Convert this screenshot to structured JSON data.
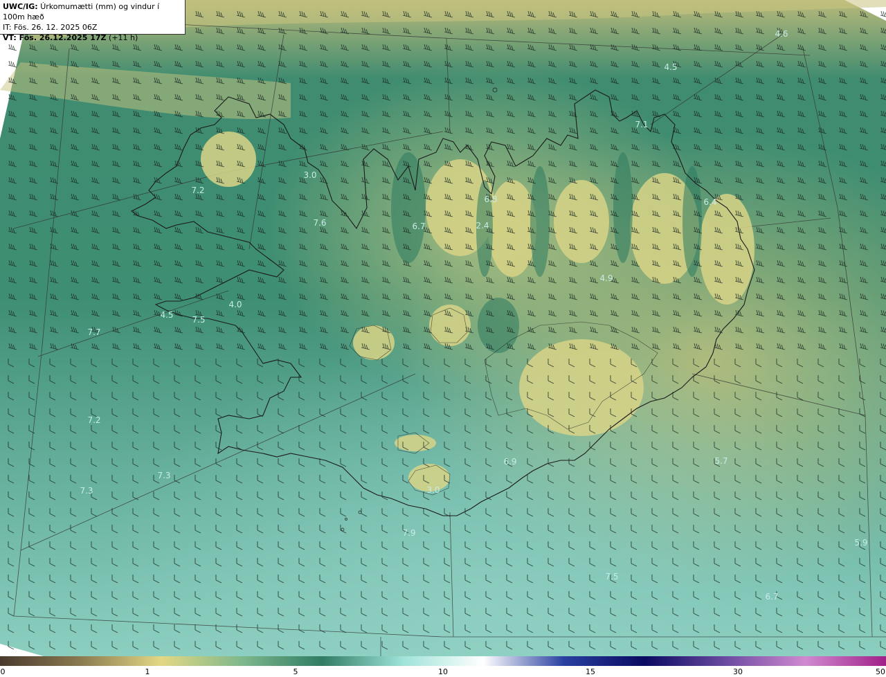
{
  "header": {
    "product_code": "UWC/IG:",
    "product_desc": "Úrkomumætti (mm) og vindur í 100m hæð",
    "it_line": "IT: Fös. 26. 12. 2025 06Z",
    "vt_label": "VT: Fös. 26.12.2025 17Z",
    "vt_offset": "(+11 h)"
  },
  "colorbar": {
    "ticks": [
      "0",
      "1",
      "5",
      "10",
      "15",
      "30",
      "50"
    ],
    "colors": [
      "#4a3a2e",
      "#8a7a50",
      "#e3d884",
      "#7fb88c",
      "#2f7c64",
      "#9fe3d8",
      "#ffffff",
      "#2a40a0",
      "#0a0a60",
      "#6a4aa0",
      "#d08ad0",
      "#a0208a"
    ]
  },
  "map_labels": [
    {
      "text": "4.6"
    },
    {
      "text": "4.5"
    },
    {
      "text": "7.1"
    },
    {
      "text": "3.0"
    },
    {
      "text": "7.2"
    },
    {
      "text": "7.6"
    },
    {
      "text": "6.7"
    },
    {
      "text": "6.8"
    },
    {
      "text": "2.4"
    },
    {
      "text": "6.4"
    },
    {
      "text": "4.9"
    },
    {
      "text": "4.0"
    },
    {
      "text": "4.5"
    },
    {
      "text": "7.5"
    },
    {
      "text": "7.7"
    },
    {
      "text": "7.2"
    },
    {
      "text": "7.3"
    },
    {
      "text": "7.3"
    },
    {
      "text": "6.9"
    },
    {
      "text": "5.7"
    },
    {
      "text": "3.0"
    },
    {
      "text": "7.9"
    },
    {
      "text": "5.9"
    },
    {
      "text": "7.5"
    },
    {
      "text": "6.7"
    }
  ],
  "colors": {
    "deep_teal": "#2d7a62",
    "mid_teal": "#4fa08a",
    "light_teal": "#8ecfc0",
    "olive_yellow": "#d9d58a",
    "coastline": "#1a1a1a",
    "barb": "#1c2a24"
  }
}
